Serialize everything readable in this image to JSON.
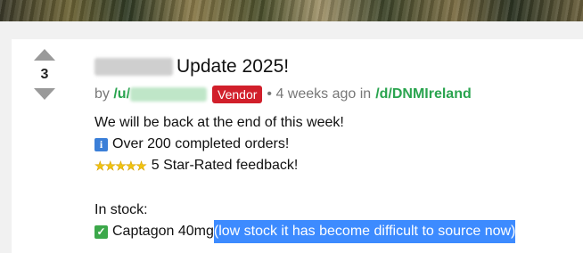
{
  "post": {
    "score": "3",
    "title": "Update 2025!",
    "author_prefix": "by",
    "author_handle": "/u/",
    "badge": "Vendor",
    "time": "• 4 weeks ago in",
    "subforum": "/d/DNMIreland"
  },
  "body": {
    "line1": "We will be back at the end of this week!",
    "line2": "Over 200 completed orders!",
    "line3": "5 Star-Rated feedback!",
    "stock_label": "In stock:",
    "item": "Captagon 40mg",
    "item_note": "(low stock it has become difficult to source now)"
  },
  "icons": {
    "info": "i",
    "stars": "★★★★★",
    "check": "✓"
  },
  "colors": {
    "vendor_badge": "#d11f2b",
    "link_green": "#2aa44f",
    "highlight": "#3d8bff"
  }
}
